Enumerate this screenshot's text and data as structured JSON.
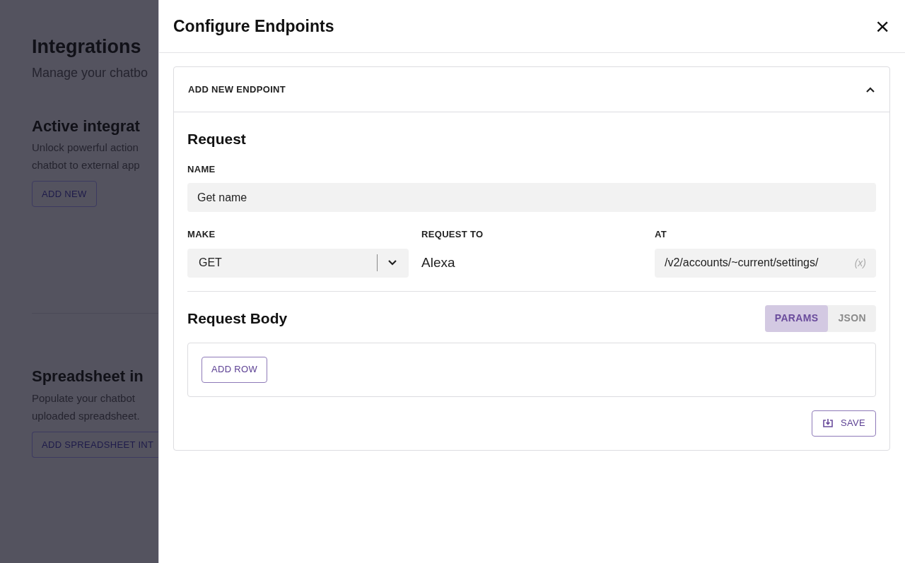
{
  "background": {
    "title": "Integrations",
    "subtitle": "Manage your chatbo",
    "sections": [
      {
        "title": "Active integrat",
        "lines": [
          "Unlock powerful action",
          "chatbot to external app"
        ],
        "button": "ADD NEW"
      },
      {
        "title": "Spreadsheet in",
        "lines": [
          "Populate your chatbot",
          "uploaded spreadsheet."
        ],
        "button": "ADD SPREADSHEET INT"
      }
    ]
  },
  "drawer": {
    "title": "Configure Endpoints",
    "close": "×",
    "panel": {
      "header": "ADD NEW ENDPOINT",
      "expanded": true,
      "request_title": "Request",
      "name": {
        "label": "NAME",
        "value": "Get name"
      },
      "make": {
        "label": "MAKE",
        "value": "GET"
      },
      "request_to": {
        "label": "REQUEST TO",
        "value": "Alexa"
      },
      "at": {
        "label": "AT",
        "value": "/v2/accounts/~current/settings/",
        "variable_button": "(x)"
      },
      "body_title": "Request Body",
      "body_tabs": [
        {
          "label": "PARAMS",
          "selected": true
        },
        {
          "label": "JSON",
          "selected": false
        }
      ],
      "add_row": "ADD ROW",
      "save": "SAVE"
    }
  }
}
